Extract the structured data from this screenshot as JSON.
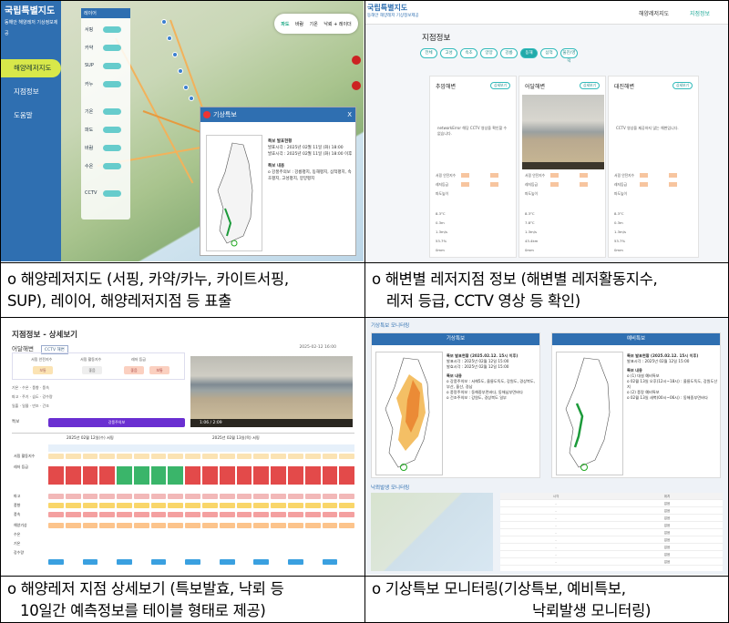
{
  "captions": {
    "c1_line1": "o 해양레저지도 (서핑, 카약/카누, 카이트서핑,",
    "c1_line2": "SUP), 레이어, 해양레저지점 등 표출",
    "c2_line1": "o 해변별 레저지점 정보 (해변별 레저활동지수,",
    "c2_line2": "레저 등급, CCTV 영상 등 확인)",
    "c3_line1": "o 해양레저 지점 상세보기 (특보발효, 낙뢰 등",
    "c3_line2": "10일간 예측정보를 테이블 형태로 제공)",
    "c4_line1": "o 기상특보 모니터링(기상특보, 예비특보,",
    "c4_line2": "낙뢰발생 모니터링)"
  },
  "panel1": {
    "logo": "국립특별지도",
    "logo_sub": "동해안 해양레저 기상정보제공",
    "menu": [
      "해양레저지도",
      "지점정보",
      "도움말"
    ],
    "top_tabs": [
      "파도",
      "바람",
      "기온",
      "낙뢰 + 레이더"
    ],
    "popup_title": "기상특보",
    "popup_close": "X",
    "popup_text_1": "특보 발표현황",
    "popup_text_2": "발표시각 : 2025년 02월 11일 (화) 18:00",
    "popup_text_3": "발효시각 : 2025년 02월 11일 (화) 18:00 이후",
    "popup_text_4": "특보 내용",
    "popup_text_5": "o 강풍주의보 : 강릉평지, 동해평지, 삼척평지, 속초평지, 고성평지, 양양평지",
    "layer_labels": [
      "서핑",
      "카약",
      "SUP",
      "카누",
      "기온",
      "파도",
      "바람",
      "수온",
      "CCTV"
    ]
  },
  "panel2": {
    "logo": "국립특별지도",
    "logo_sub": "동해안 해양레저 기상정보제공",
    "nav": [
      "해양레저지도",
      "지점정보"
    ],
    "title": "지점정보",
    "chips": [
      "전체",
      "고성",
      "속초",
      "양양",
      "강릉",
      "동해",
      "삼척",
      "울진/영덕"
    ],
    "cards": [
      {
        "name": "추암해변",
        "detail": "상세보기",
        "msg": "networkError 해당 CCTV 영상을 확인할 수 없습니다."
      },
      {
        "name": "어달해변",
        "detail": "상세보기",
        "msg": ""
      },
      {
        "name": "대진해변",
        "detail": "상세보기",
        "msg": "CCTV 영상을 제공하지 않는 해변입니다."
      }
    ],
    "row_labels": [
      "서핑 안전지수",
      "레저등급",
      "파도높이"
    ],
    "weather_vals": [
      "8.3°C",
      "0.3m",
      "7.8°C",
      "1.3m/s",
      "43.4km",
      "53.7%",
      "0mm"
    ]
  },
  "panel3": {
    "title": "지점정보 - 상세보기",
    "beach": "어달해변",
    "beach_tag": "CCTV 해변",
    "timestamp": "2025-02-12 16:00",
    "labels": [
      "서핑 안전지수",
      "서핑 활동지수",
      "레저 등급"
    ],
    "pills": [
      "보통",
      "좋음",
      "좋음",
      "보통"
    ],
    "video_time": "1:06 / 2:09",
    "stat_label": "특보",
    "stat_value": "강풍주의보",
    "date1": "2025년 02월 12일(수) 서핑",
    "date2": "2025년 02월 13일(목) 서핑",
    "row_labels": [
      "서핑 활동지수",
      "레저 등급",
      "파고",
      "풍향",
      "풍속",
      "해양기상",
      "수온",
      "기온",
      "강수량"
    ]
  },
  "panel4": {
    "section1": "기상특보 모니터링",
    "box1_title": "기상특보",
    "box2_title": "예비특보",
    "box1_text": [
      "특보 발표현황 (2025.02.12. 15시 이후)",
      "발표시각 : 2025년 02월 12일 15:00",
      "발효시각 : 2025년 02월 12일 15:00",
      "특보 내용",
      "o 강풍주의보 : 서해5도, 울릉도독도, 강원도, 경상북도, 부산, 울산, 경남",
      "o 풍랑주의보 : 동해중부먼바다, 동해남부먼바다",
      "o 건조주의보 : 강원도, 경상북도 일부"
    ],
    "box2_text": [
      "특보 발표현황 (2025.02.12. 15시 이후)",
      "발표시각 : 2025년 02월 12일 15:00",
      "특보 내용",
      "o (1) 대설 예비특보",
      "o 02월 13일 오후(12시~18시) : 울릉도독도, 강원도산지",
      "o (2) 풍랑 예비특보",
      "o 02월 13일 새벽(00시~06시) : 동해중부먼바다"
    ],
    "section2": "낙뢰발생 모니터링",
    "table_head": [
      "시각",
      "위치"
    ],
    "table_rows": [
      [
        "-",
        "없음"
      ],
      [
        "-",
        "없음"
      ],
      [
        "-",
        "없음"
      ],
      [
        "-",
        "없음"
      ],
      [
        "-",
        "없음"
      ],
      [
        "-",
        "없음"
      ],
      [
        "-",
        "없음"
      ],
      [
        "-",
        "없음"
      ],
      [
        "-",
        "없음"
      ]
    ]
  },
  "colors": {
    "brand_blue": "#2f6fb1",
    "accent_teal": "#2aa8a8",
    "accent_lime": "#d8e84a",
    "purple": "#6a2fd1"
  }
}
